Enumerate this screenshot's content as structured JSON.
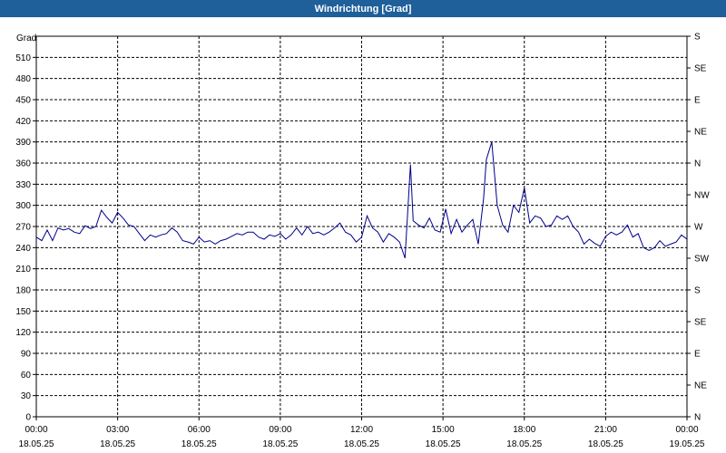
{
  "window": {
    "title": "Windrichtung [Grad]"
  },
  "chart_data": {
    "type": "line",
    "title": "Windrichtung [Grad]",
    "ylabel": "Grad",
    "ylim": [
      0,
      540
    ],
    "yticks": [
      0,
      30,
      60,
      90,
      120,
      150,
      180,
      210,
      240,
      270,
      300,
      330,
      360,
      390,
      420,
      450,
      480,
      510
    ],
    "y2ticks": [
      {
        "value": 0,
        "label": "N"
      },
      {
        "value": 45,
        "label": "NE"
      },
      {
        "value": 90,
        "label": "E"
      },
      {
        "value": 135,
        "label": "SE"
      },
      {
        "value": 180,
        "label": "S"
      },
      {
        "value": 225,
        "label": "SW"
      },
      {
        "value": 270,
        "label": "W"
      },
      {
        "value": 315,
        "label": "NW"
      },
      {
        "value": 360,
        "label": "N"
      },
      {
        "value": 405,
        "label": "NE"
      },
      {
        "value": 450,
        "label": "E"
      },
      {
        "value": 495,
        "label": "SE"
      },
      {
        "value": 540,
        "label": "S"
      }
    ],
    "xlim": [
      0,
      24
    ],
    "xticks": [
      {
        "hours": 0,
        "time": "00:00",
        "date": "18.05.25"
      },
      {
        "hours": 3,
        "time": "03:00",
        "date": "18.05.25"
      },
      {
        "hours": 6,
        "time": "06:00",
        "date": "18.05.25"
      },
      {
        "hours": 9,
        "time": "09:00",
        "date": "18.05.25"
      },
      {
        "hours": 12,
        "time": "12:00",
        "date": "18.05.25"
      },
      {
        "hours": 15,
        "time": "15:00",
        "date": "18.05.25"
      },
      {
        "hours": 18,
        "time": "18:00",
        "date": "18.05.25"
      },
      {
        "hours": 21,
        "time": "21:00",
        "date": "18.05.25"
      },
      {
        "hours": 24,
        "time": "00:00",
        "date": "19.05.25"
      }
    ],
    "grid": true,
    "line_color": "#00008b",
    "x": [
      0,
      0.2,
      0.4,
      0.6,
      0.8,
      1.0,
      1.2,
      1.4,
      1.6,
      1.8,
      2.0,
      2.2,
      2.4,
      2.6,
      2.8,
      3.0,
      3.2,
      3.4,
      3.6,
      3.8,
      4.0,
      4.2,
      4.4,
      4.6,
      4.8,
      5.0,
      5.2,
      5.4,
      5.6,
      5.8,
      6.0,
      6.2,
      6.4,
      6.6,
      6.8,
      7.0,
      7.2,
      7.4,
      7.6,
      7.8,
      8.0,
      8.2,
      8.4,
      8.6,
      8.8,
      9.0,
      9.2,
      9.4,
      9.6,
      9.8,
      10.0,
      10.2,
      10.4,
      10.6,
      10.8,
      11.0,
      11.2,
      11.4,
      11.6,
      11.8,
      12.0,
      12.2,
      12.4,
      12.6,
      12.8,
      13.0,
      13.2,
      13.4,
      13.6,
      13.8,
      13.9,
      14.1,
      14.3,
      14.5,
      14.7,
      14.9,
      15.1,
      15.3,
      15.5,
      15.7,
      15.9,
      16.1,
      16.3,
      16.5,
      16.6,
      16.8,
      17.0,
      17.2,
      17.4,
      17.6,
      17.8,
      18.0,
      18.2,
      18.4,
      18.6,
      18.8,
      19.0,
      19.2,
      19.4,
      19.6,
      19.8,
      20.0,
      20.2,
      20.4,
      20.6,
      20.8,
      21.0,
      21.2,
      21.4,
      21.6,
      21.8,
      22.0,
      22.2,
      22.4,
      22.6,
      22.8,
      23.0,
      23.2,
      23.4,
      23.6,
      23.8,
      24.0
    ],
    "y": [
      255,
      250,
      265,
      250,
      268,
      265,
      267,
      262,
      260,
      271,
      267,
      270,
      293,
      283,
      275,
      290,
      282,
      272,
      270,
      260,
      250,
      258,
      255,
      258,
      260,
      268,
      262,
      250,
      248,
      245,
      255,
      248,
      250,
      245,
      250,
      252,
      256,
      260,
      258,
      262,
      262,
      255,
      252,
      258,
      256,
      260,
      252,
      258,
      268,
      258,
      270,
      260,
      262,
      258,
      262,
      268,
      275,
      262,
      258,
      248,
      255,
      285,
      268,
      262,
      248,
      260,
      255,
      248,
      225,
      358,
      278,
      272,
      268,
      282,
      265,
      262,
      295,
      260,
      280,
      262,
      272,
      280,
      245,
      310,
      365,
      390,
      300,
      272,
      262,
      300,
      290,
      325,
      275,
      285,
      282,
      270,
      272,
      285,
      280,
      285,
      270,
      262,
      245,
      252,
      246,
      242,
      256,
      262,
      258,
      262,
      272,
      255,
      260,
      240,
      236,
      240,
      250,
      242,
      245,
      248,
      258,
      252,
      262,
      260,
      264,
      268
    ]
  }
}
